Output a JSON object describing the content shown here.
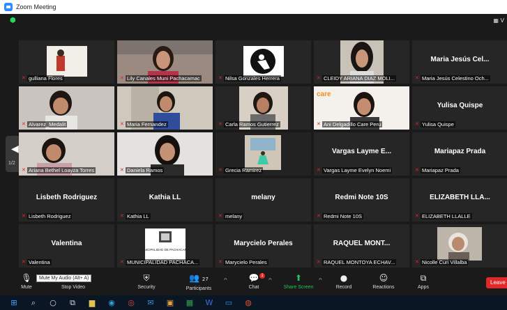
{
  "window": {
    "title": "Zoom Meeting",
    "view_label": "▦ V"
  },
  "grid": {
    "page_indicator": "1/2",
    "tiles": [
      {
        "label": "gulliana Flores",
        "big": ""
      },
      {
        "label": "Lily Canales Muni Pachacamac",
        "big": ""
      },
      {
        "label": "Nilsa Gonzales Herrera",
        "big": ""
      },
      {
        "label": "CLEIDY ARIANA DIAZ MOLI...",
        "big": ""
      },
      {
        "label": "Maria Jesús Celestino Och...",
        "big": "Maria Jesús Cel..."
      },
      {
        "label": "Alvarez_Medalit",
        "big": ""
      },
      {
        "label": "Maria Fernandez",
        "big": ""
      },
      {
        "label": "Carla Ramos Gutierrez",
        "big": ""
      },
      {
        "label": "Ani Delgadillo Care Peru",
        "big": ""
      },
      {
        "label": "Yulisa Quispe",
        "big": "Yulisa Quispe"
      },
      {
        "label": "Ariana Bethel Loayza Torres",
        "big": ""
      },
      {
        "label": "Daniela Ramos",
        "big": ""
      },
      {
        "label": "Grecia Ramirez",
        "big": ""
      },
      {
        "label": "Vargas Layme Evelyn Noemi",
        "big": "Vargas Layme E..."
      },
      {
        "label": "Mariapaz Prada",
        "big": "Mariapaz Prada"
      },
      {
        "label": "Lisbeth Rodriguez",
        "big": "Lisbeth Rodriguez"
      },
      {
        "label": "Kathia LL",
        "big": "Kathia LL"
      },
      {
        "label": "melany",
        "big": "melany"
      },
      {
        "label": "Redmi Note 10S",
        "big": "Redmi Note 10S"
      },
      {
        "label": "ELIZABETH LLALLE",
        "big": "ELIZABETH LLA..."
      },
      {
        "label": "Valentina",
        "big": "Valentina"
      },
      {
        "label": "MUNICIPALIDAD PACHACA...",
        "big": ""
      },
      {
        "label": "Marycielo Perales",
        "big": "Marycielo Perales"
      },
      {
        "label": "RAQUEL MONTOYA ECHAV...",
        "big": "RAQUEL MONT..."
      },
      {
        "label": "Nicolle Curi Villalba",
        "big": ""
      }
    ],
    "logo_text": "MUNICIPALIDAD DE PACHACAMAC",
    "care_text": "care"
  },
  "toolbar": {
    "tooltip": "Mute My Audio (Alt+ A)",
    "mute": "Mute",
    "stop_video": "Stop Video",
    "security": "Security",
    "participants": "Participants",
    "participants_count": "27",
    "chat": "Chat",
    "chat_badge": "1",
    "share_screen": "Share Screen",
    "record": "Record",
    "reactions": "Reactions",
    "apps": "Apps",
    "leave": "Leave"
  },
  "colors": {
    "accent": "#2d8cff",
    "muted": "#e02828",
    "share": "#23c357",
    "active_border": "#c8e64a"
  }
}
